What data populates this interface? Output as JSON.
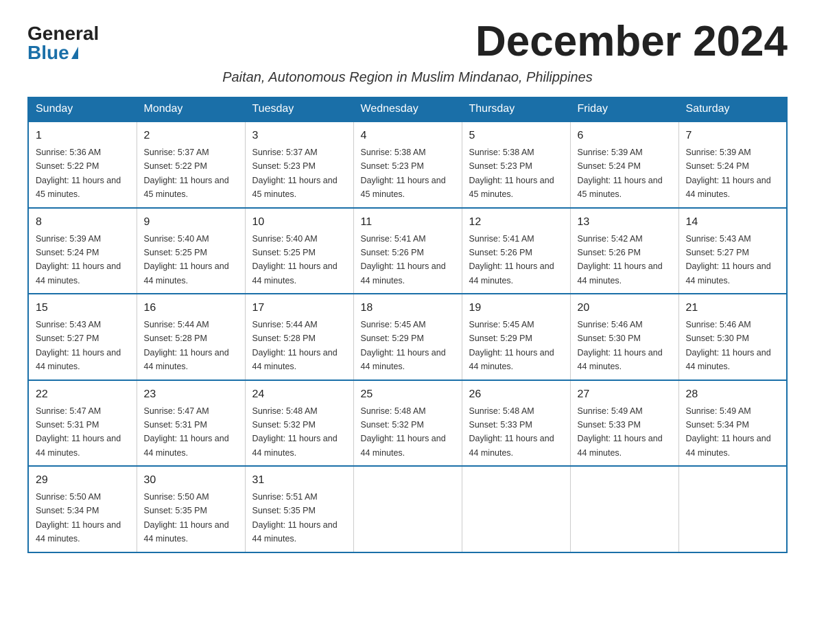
{
  "logo": {
    "general": "General",
    "blue": "Blue"
  },
  "title": "December 2024",
  "subtitle": "Paitan, Autonomous Region in Muslim Mindanao, Philippines",
  "days_of_week": [
    "Sunday",
    "Monday",
    "Tuesday",
    "Wednesday",
    "Thursday",
    "Friday",
    "Saturday"
  ],
  "weeks": [
    [
      {
        "day": "1",
        "sunrise": "5:36 AM",
        "sunset": "5:22 PM",
        "daylight": "11 hours and 45 minutes."
      },
      {
        "day": "2",
        "sunrise": "5:37 AM",
        "sunset": "5:22 PM",
        "daylight": "11 hours and 45 minutes."
      },
      {
        "day": "3",
        "sunrise": "5:37 AM",
        "sunset": "5:23 PM",
        "daylight": "11 hours and 45 minutes."
      },
      {
        "day": "4",
        "sunrise": "5:38 AM",
        "sunset": "5:23 PM",
        "daylight": "11 hours and 45 minutes."
      },
      {
        "day": "5",
        "sunrise": "5:38 AM",
        "sunset": "5:23 PM",
        "daylight": "11 hours and 45 minutes."
      },
      {
        "day": "6",
        "sunrise": "5:39 AM",
        "sunset": "5:24 PM",
        "daylight": "11 hours and 45 minutes."
      },
      {
        "day": "7",
        "sunrise": "5:39 AM",
        "sunset": "5:24 PM",
        "daylight": "11 hours and 44 minutes."
      }
    ],
    [
      {
        "day": "8",
        "sunrise": "5:39 AM",
        "sunset": "5:24 PM",
        "daylight": "11 hours and 44 minutes."
      },
      {
        "day": "9",
        "sunrise": "5:40 AM",
        "sunset": "5:25 PM",
        "daylight": "11 hours and 44 minutes."
      },
      {
        "day": "10",
        "sunrise": "5:40 AM",
        "sunset": "5:25 PM",
        "daylight": "11 hours and 44 minutes."
      },
      {
        "day": "11",
        "sunrise": "5:41 AM",
        "sunset": "5:26 PM",
        "daylight": "11 hours and 44 minutes."
      },
      {
        "day": "12",
        "sunrise": "5:41 AM",
        "sunset": "5:26 PM",
        "daylight": "11 hours and 44 minutes."
      },
      {
        "day": "13",
        "sunrise": "5:42 AM",
        "sunset": "5:26 PM",
        "daylight": "11 hours and 44 minutes."
      },
      {
        "day": "14",
        "sunrise": "5:43 AM",
        "sunset": "5:27 PM",
        "daylight": "11 hours and 44 minutes."
      }
    ],
    [
      {
        "day": "15",
        "sunrise": "5:43 AM",
        "sunset": "5:27 PM",
        "daylight": "11 hours and 44 minutes."
      },
      {
        "day": "16",
        "sunrise": "5:44 AM",
        "sunset": "5:28 PM",
        "daylight": "11 hours and 44 minutes."
      },
      {
        "day": "17",
        "sunrise": "5:44 AM",
        "sunset": "5:28 PM",
        "daylight": "11 hours and 44 minutes."
      },
      {
        "day": "18",
        "sunrise": "5:45 AM",
        "sunset": "5:29 PM",
        "daylight": "11 hours and 44 minutes."
      },
      {
        "day": "19",
        "sunrise": "5:45 AM",
        "sunset": "5:29 PM",
        "daylight": "11 hours and 44 minutes."
      },
      {
        "day": "20",
        "sunrise": "5:46 AM",
        "sunset": "5:30 PM",
        "daylight": "11 hours and 44 minutes."
      },
      {
        "day": "21",
        "sunrise": "5:46 AM",
        "sunset": "5:30 PM",
        "daylight": "11 hours and 44 minutes."
      }
    ],
    [
      {
        "day": "22",
        "sunrise": "5:47 AM",
        "sunset": "5:31 PM",
        "daylight": "11 hours and 44 minutes."
      },
      {
        "day": "23",
        "sunrise": "5:47 AM",
        "sunset": "5:31 PM",
        "daylight": "11 hours and 44 minutes."
      },
      {
        "day": "24",
        "sunrise": "5:48 AM",
        "sunset": "5:32 PM",
        "daylight": "11 hours and 44 minutes."
      },
      {
        "day": "25",
        "sunrise": "5:48 AM",
        "sunset": "5:32 PM",
        "daylight": "11 hours and 44 minutes."
      },
      {
        "day": "26",
        "sunrise": "5:48 AM",
        "sunset": "5:33 PM",
        "daylight": "11 hours and 44 minutes."
      },
      {
        "day": "27",
        "sunrise": "5:49 AM",
        "sunset": "5:33 PM",
        "daylight": "11 hours and 44 minutes."
      },
      {
        "day": "28",
        "sunrise": "5:49 AM",
        "sunset": "5:34 PM",
        "daylight": "11 hours and 44 minutes."
      }
    ],
    [
      {
        "day": "29",
        "sunrise": "5:50 AM",
        "sunset": "5:34 PM",
        "daylight": "11 hours and 44 minutes."
      },
      {
        "day": "30",
        "sunrise": "5:50 AM",
        "sunset": "5:35 PM",
        "daylight": "11 hours and 44 minutes."
      },
      {
        "day": "31",
        "sunrise": "5:51 AM",
        "sunset": "5:35 PM",
        "daylight": "11 hours and 44 minutes."
      },
      null,
      null,
      null,
      null
    ]
  ],
  "labels": {
    "sunrise_prefix": "Sunrise: ",
    "sunset_prefix": "Sunset: ",
    "daylight_prefix": "Daylight: "
  }
}
